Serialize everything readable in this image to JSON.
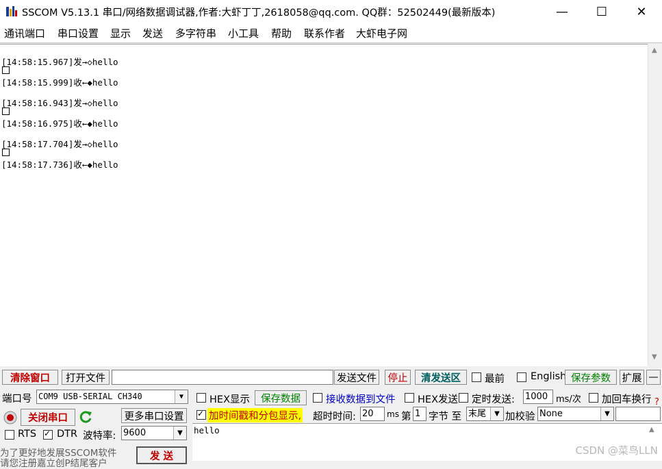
{
  "title": "SSCOM V5.13.1 串口/网络数据调试器,作者:大虾丁丁,2618058@qq.com. QQ群：52502449(最新版本)",
  "window_controls": {
    "minimize": "—",
    "maximize": "☐",
    "close": "✕"
  },
  "menu": [
    "通讯端口",
    "串口设置",
    "显示",
    "发送",
    "多字符串",
    "小工具",
    "帮助",
    "联系作者",
    "大虾电子网"
  ],
  "log": [
    "[14:58:15.967]发→◇hello",
    "[14:58:15.999]收←◆hello",
    "[14:58:16.943]发→◇hello",
    "[14:58:16.975]收←◆hello",
    "[14:58:17.704]发→◇hello",
    "[14:58:17.736]收←◆hello"
  ],
  "toolbar": {
    "clear_window": "清除窗口",
    "open_file": "打开文件",
    "file_path": "",
    "send_file": "发送文件",
    "stop": "停止",
    "clear_send": "清发送区",
    "latest": "最前",
    "english": "English",
    "save_params": "保存参数",
    "expand": "扩展",
    "collapse": "—"
  },
  "port": {
    "port_label": "端口号",
    "port_value": "COM9 USB-SERIAL CH340",
    "hex_display": "HEX显示",
    "save_data": "保存数据",
    "recv_to_file": "接收数据到文件",
    "hex_send": "HEX发送",
    "timed_send": "定时发送:",
    "interval": "1000",
    "interval_unit": "ms/次",
    "add_crlf": "加回车换行",
    "close_port": "关闭串口",
    "more_settings": "更多串口设置",
    "timestamp": "加时间戳和分包显示,",
    "timeout_label": "超时时间:",
    "timeout": "20",
    "timeout_unit": "ms",
    "nth_label": "第",
    "nth": "1",
    "byte_label": "字节 至",
    "end": "末尾",
    "checksum_label": "加校验",
    "checksum": "None",
    "rts": "RTS",
    "dtr": "DTR",
    "baud_label": "波特率:",
    "baud": "9600",
    "promo": "为了更好地发展SSCOM软件",
    "promo2": "请您注册嘉立创P结尾客户",
    "send_button": "发 送"
  },
  "send_text": "hello",
  "watermark": "CSDN @菜鸟LLN"
}
